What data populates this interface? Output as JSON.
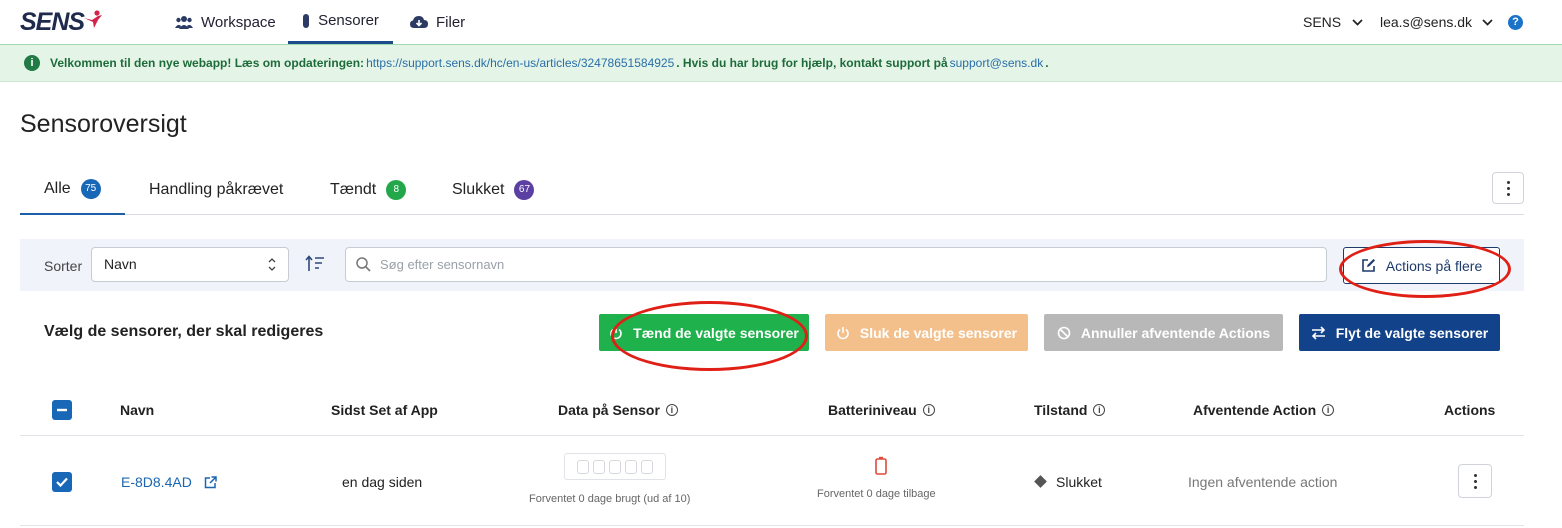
{
  "app": {
    "logo_text": "SENS"
  },
  "nav": {
    "items": [
      {
        "label": "Workspace",
        "icon": "people-group-icon"
      },
      {
        "label": "Sensorer",
        "icon": "sensor-icon"
      },
      {
        "label": "Filer",
        "icon": "cloud-download-icon"
      }
    ],
    "org": "SENS",
    "user": "lea.s@sens.dk",
    "help": "?"
  },
  "banner": {
    "lead": "Velkommen til den nye webapp! Læs om opdateringen:",
    "link": "https://support.sens.dk/hc/en-us/articles/32478651584925",
    "middle": ". Hvis du har brug for hjælp, kontakt support på",
    "email": "support@sens.dk",
    "end": "."
  },
  "page": {
    "title": "Sensoroversigt"
  },
  "tabs": [
    {
      "label": "Alle",
      "count": "75",
      "color": "#1967b7"
    },
    {
      "label": "Handling påkrævet",
      "count": ""
    },
    {
      "label": "Tændt",
      "count": "8",
      "color": "#22a84a"
    },
    {
      "label": "Slukket",
      "count": "67",
      "color": "#5b3fa3"
    }
  ],
  "filter": {
    "sort_label": "Sorter",
    "sort_value": "Navn",
    "search_placeholder": "Søg efter sensornavn",
    "actions_many": "Actions på flere"
  },
  "bulk": {
    "label": "Vælg de sensorer, der skal redigeres",
    "turn_on": "Tænd de valgte sensorer",
    "turn_off": "Sluk de valgte sensorer",
    "cancel": "Annuller afventende Actions",
    "move": "Flyt de valgte sensorer",
    "colors": {
      "on": "#1fb14b",
      "off": "#f3c08c",
      "cancel": "#b8b8b8",
      "move": "#12438a"
    }
  },
  "table": {
    "headers": {
      "name": "Navn",
      "last_seen": "Sidst Set af App",
      "data": "Data på Sensor",
      "battery": "Batteriniveau",
      "state": "Tilstand",
      "pending": "Afventende Action",
      "actions": "Actions"
    },
    "rows": [
      {
        "name": "E-8D8.4AD",
        "last_seen": "en dag siden",
        "data_note": "Forventet 0 dage brugt (ud af 10)",
        "battery_note": "Forventet 0 dage tilbage",
        "state": "Slukket",
        "pending": "Ingen afventende action"
      }
    ]
  }
}
